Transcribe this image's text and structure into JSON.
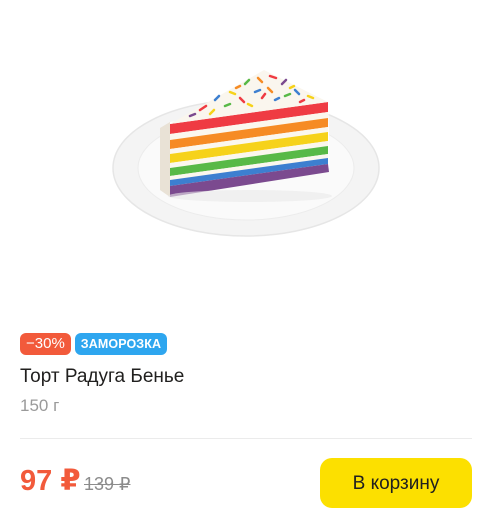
{
  "product": {
    "badges": {
      "discount": "−30%",
      "frozen": "ЗАМОРОЗКА"
    },
    "title": "Торт Радуга Бенье",
    "weight": "150 г",
    "price": "97 ₽",
    "old_price": "139 ₽",
    "add_to_cart_label": "В корзину",
    "image_alt": "rainbow-cake-slice-image"
  },
  "colors": {
    "accent_discount": "#f25a3b",
    "badge_frozen": "#2ea6ef",
    "cart_button": "#fce000",
    "text_primary": "#21201f",
    "text_secondary": "#9a9a9a"
  }
}
